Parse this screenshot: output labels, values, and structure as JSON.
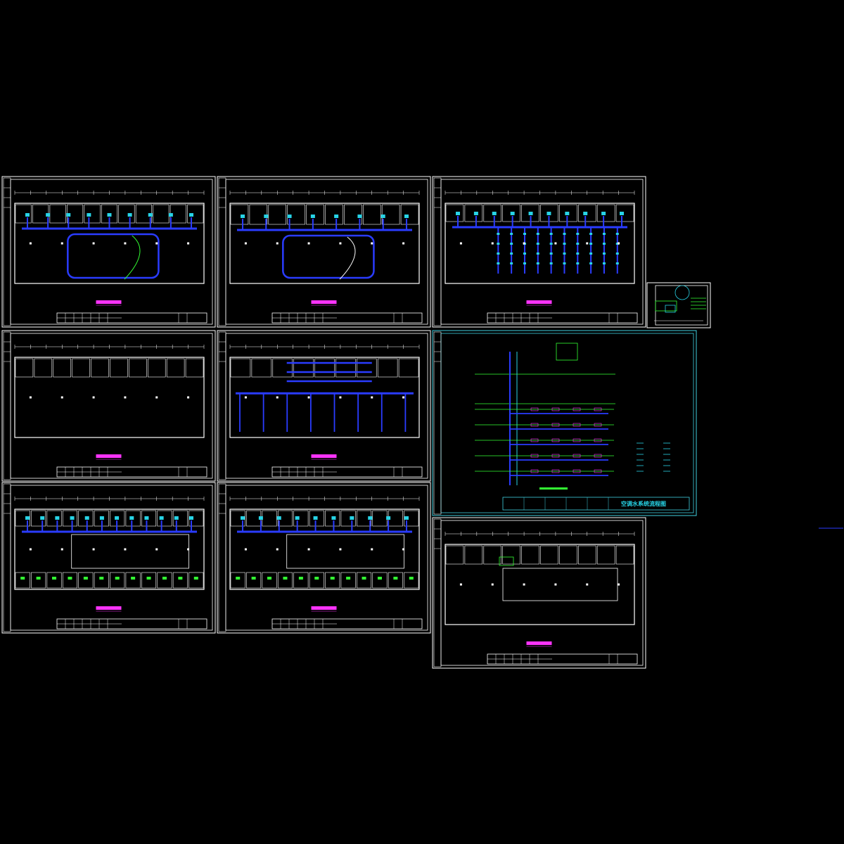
{
  "canvas": {
    "background": "#000000"
  },
  "colors": {
    "frame": "#ffffff",
    "wall": "#ffffff",
    "duct": "#2a3cff",
    "pipe_cyan": "#27d3e6",
    "pipe_green": "#33ff33",
    "title_magenta": "#ff33ff",
    "frame_cyan": "#3fd0e0"
  },
  "sheets": [
    {
      "id": "sheet-1",
      "kind": "plan",
      "style": "office",
      "title_text": "",
      "stamp": ""
    },
    {
      "id": "sheet-2",
      "kind": "plan",
      "style": "hall",
      "title_text": "",
      "stamp": ""
    },
    {
      "id": "sheet-3",
      "kind": "plan",
      "style": "grid",
      "title_text": "",
      "stamp": ""
    },
    {
      "id": "sheet-4",
      "kind": "plan",
      "style": "empty",
      "title_text": "",
      "stamp": ""
    },
    {
      "id": "sheet-5",
      "kind": "plan",
      "style": "dense",
      "title_text": "",
      "stamp": ""
    },
    {
      "id": "sheet-6",
      "kind": "schematic",
      "style": "water",
      "title_text": "空调水系统流程图",
      "stamp": ""
    },
    {
      "id": "sheet-7",
      "kind": "plan",
      "style": "rooms",
      "title_text": "",
      "stamp": ""
    },
    {
      "id": "sheet-8",
      "kind": "plan",
      "style": "rooms2",
      "title_text": "",
      "stamp": ""
    },
    {
      "id": "sheet-9",
      "kind": "plan",
      "style": "roof",
      "title_text": "",
      "stamp": ""
    },
    {
      "id": "sheet-10",
      "kind": "detail",
      "style": "detail",
      "title_text": "",
      "stamp": ""
    }
  ]
}
